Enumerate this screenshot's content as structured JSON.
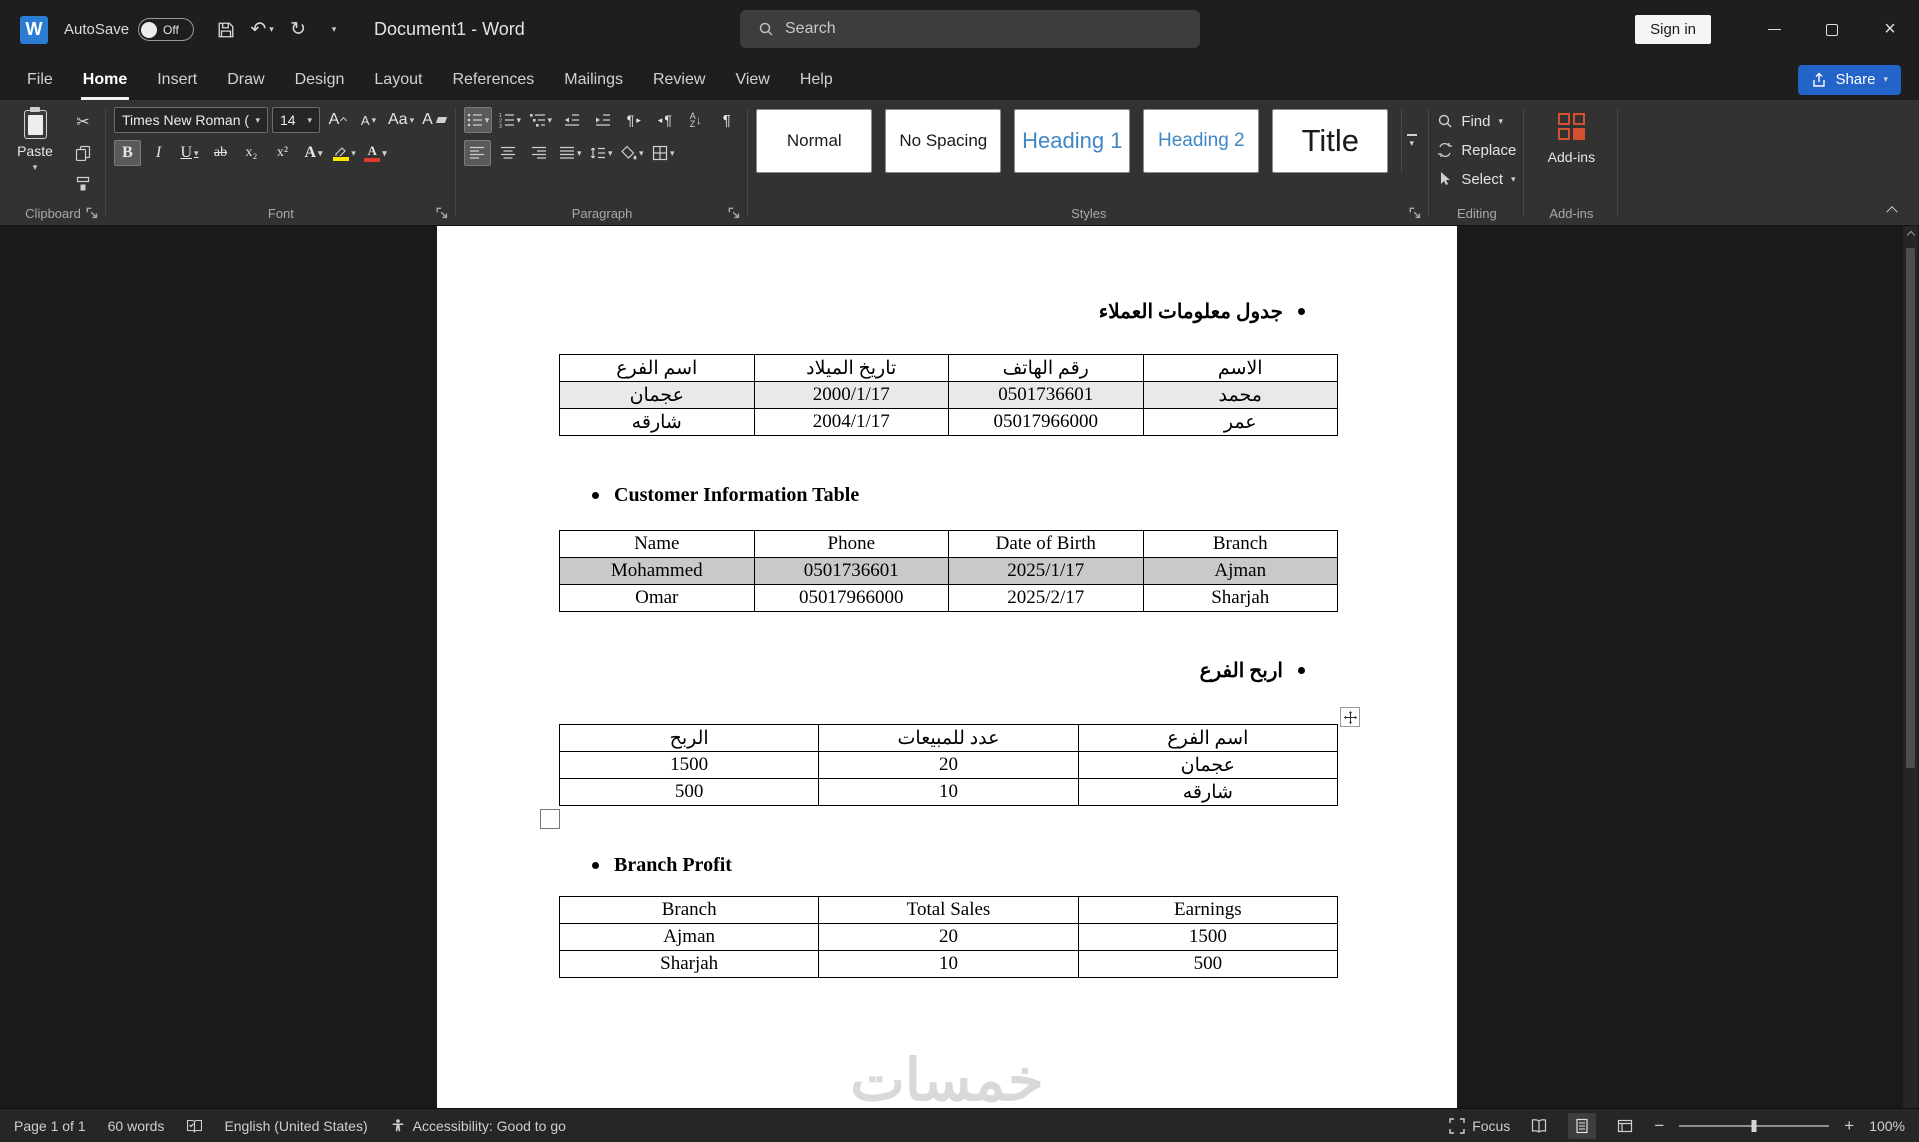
{
  "colors": {
    "share_blue": "#2463c8",
    "heading_style_blue": "#3f87c5",
    "highlight_yellow": "#ffe400",
    "font_color_red": "#e23b2e",
    "addins_orange": "#d4502e",
    "word_brand_blue": "#2b7cd3"
  },
  "titlebar": {
    "autosave_label": "AutoSave",
    "autosave_state": "Off",
    "doc_title": "Document1 - Word",
    "search_placeholder": "Search",
    "sign_in": "Sign in"
  },
  "ribbon": {
    "tabs": [
      "File",
      "Home",
      "Insert",
      "Draw",
      "Design",
      "Layout",
      "References",
      "Mailings",
      "Review",
      "View",
      "Help"
    ],
    "active_tab": "Home",
    "share_label": "Share",
    "clipboard": {
      "paste_label": "Paste",
      "group_label": "Clipboard"
    },
    "font": {
      "family": "Times New Roman (",
      "size": "14",
      "group_label": "Font",
      "grow": "A",
      "shrink": "A",
      "change_case": "Aa",
      "clear": "A",
      "bold": "B",
      "italic": "I",
      "underline": "U",
      "strikethrough": "ab",
      "subscript": "x₂",
      "superscript": "x²",
      "text_effects": "A",
      "font_color": "A"
    },
    "paragraph": {
      "group_label": "Paragraph",
      "pilcrow": "¶",
      "sort_a": "A",
      "sort_z": "Z"
    },
    "styles": {
      "group_label": "Styles",
      "items": [
        "Normal",
        "No Spacing",
        "Heading 1",
        "Heading 2",
        "Title"
      ]
    },
    "editing": {
      "group_label": "Editing",
      "find": "Find",
      "replace": "Replace",
      "select": "Select"
    },
    "addins": {
      "group_label": "Add-ins",
      "button_label": "Add-ins"
    }
  },
  "document": {
    "headings": [
      {
        "text": "جدول معلومات العملاء"
      },
      {
        "text": "Customer Information Table"
      },
      {
        "text": "اربح الفرع"
      },
      {
        "text": "Branch Profit"
      }
    ],
    "tables": [
      {
        "headers": [
          "اسم الفرع",
          "تاريخ الميلاد",
          "رقم الهاتف",
          "الاسم"
        ],
        "rows": [
          [
            "عجمان",
            "2000/1/17",
            "0501736601",
            "محمد"
          ],
          [
            "شارقه",
            "2004/1/17",
            "05017966000",
            "عمر"
          ]
        ],
        "row_bg": [
          "#e9e9e9",
          ""
        ]
      },
      {
        "headers": [
          "Name",
          "Phone",
          "Date of Birth",
          "Branch"
        ],
        "rows": [
          [
            "Mohammed",
            "0501736601",
            "2025/1/17",
            "Ajman"
          ],
          [
            "Omar",
            "05017966000",
            "2025/2/17",
            "Sharjah"
          ]
        ],
        "row_bg": [
          "#c9c9c9",
          ""
        ]
      },
      {
        "headers": [
          "الربح",
          "عدد للمبيعات",
          "اسم الفرع"
        ],
        "rows": [
          [
            "1500",
            "20",
            "عجمان"
          ],
          [
            "500",
            "10",
            "شارقه"
          ]
        ],
        "row_bg": [
          "",
          ""
        ]
      },
      {
        "headers": [
          "Branch",
          "Total Sales",
          "Earnings"
        ],
        "rows": [
          [
            "Ajman",
            "20",
            "1500"
          ],
          [
            "Sharjah",
            "10",
            "500"
          ]
        ],
        "row_bg": [
          "",
          ""
        ]
      }
    ],
    "watermark": "خمسات"
  },
  "statusbar": {
    "page": "Page 1 of 1",
    "words": "60 words",
    "language": "English (United States)",
    "accessibility": "Accessibility: Good to go",
    "focus": "Focus",
    "zoom": "100%"
  }
}
